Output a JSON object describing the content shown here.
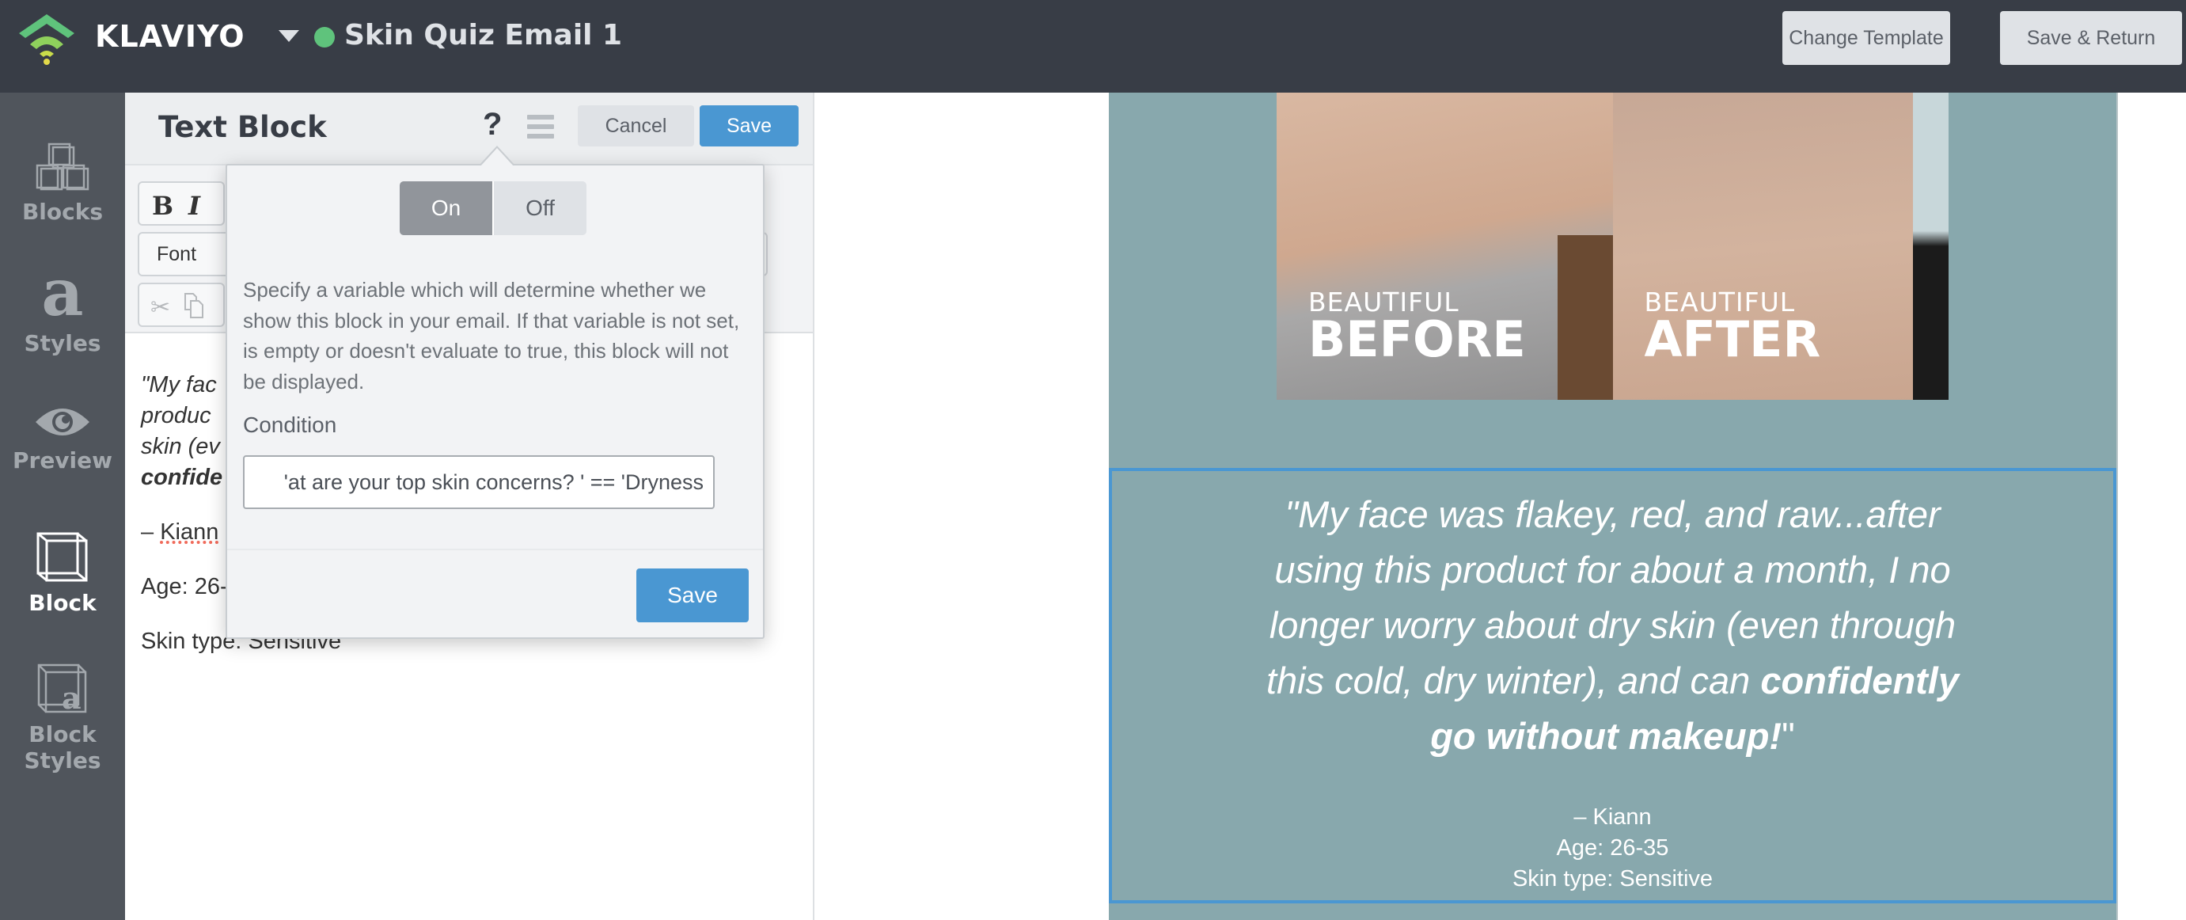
{
  "header": {
    "brand": "KLAVIYO",
    "email_title": "Skin Quiz Email 1",
    "status_color": "#5fc37c",
    "buttons": {
      "change_template": "Change Template",
      "save_return": "Save & Return"
    }
  },
  "sidenav": {
    "items": [
      {
        "label": "Blocks",
        "icon": "blocks-icon",
        "active": false
      },
      {
        "label": "Styles",
        "icon": "styles-icon",
        "active": false
      },
      {
        "label": "Preview",
        "icon": "eye-icon",
        "active": false
      },
      {
        "label": "Block",
        "icon": "block-cube-icon",
        "active": true
      },
      {
        "label": "Block Styles",
        "label_line1": "Block",
        "label_line2": "Styles",
        "icon": "block-styles-icon",
        "active": false
      }
    ]
  },
  "editor": {
    "title": "Text Block",
    "help_glyph": "?",
    "cancel_label": "Cancel",
    "save_label": "Save",
    "toolbar": {
      "bold": "B",
      "italic": "I",
      "font_label": "Font",
      "cut_glyph": "✂"
    },
    "content": {
      "quote_line1": "\"My fac",
      "quote_line2": "produc",
      "quote_line3": "skin (ev",
      "quote_line4_bold": "confide",
      "author_dash": "– ",
      "author_name": "Kiann",
      "age": "Age: 26-",
      "skin_type": "Skin type: Sensitive"
    }
  },
  "popover": {
    "toggle": {
      "on": "On",
      "off": "Off",
      "selected": "On"
    },
    "description": "Specify a variable which will determine whether we show this block in your email. If that variable is not set, is empty or doesn't evaluate to true, this block will not be displayed.",
    "condition_label": "Condition",
    "condition_value": "at are your top skin concerns? ' == 'Dryness'",
    "save_label": "Save"
  },
  "email": {
    "background": "#88a8ad",
    "hero": {
      "before_small": "BEAUTIFUL",
      "before_big": "BEFORE",
      "after_small": "BEAUTIFUL",
      "after_big": "AFTER"
    },
    "testimonial": {
      "quote_regular": "\"My face was flakey, red, and raw...after using this product for about a month, I no longer worry about dry skin (even through this cold, dry winter), and can ",
      "quote_bold": "confidently go without makeup!",
      "quote_close": "\"",
      "author": "– Kiann",
      "age": "Age: 26-35",
      "skin_type": "Skin type: Sensitive"
    },
    "selection_color": "#4a97d2"
  }
}
